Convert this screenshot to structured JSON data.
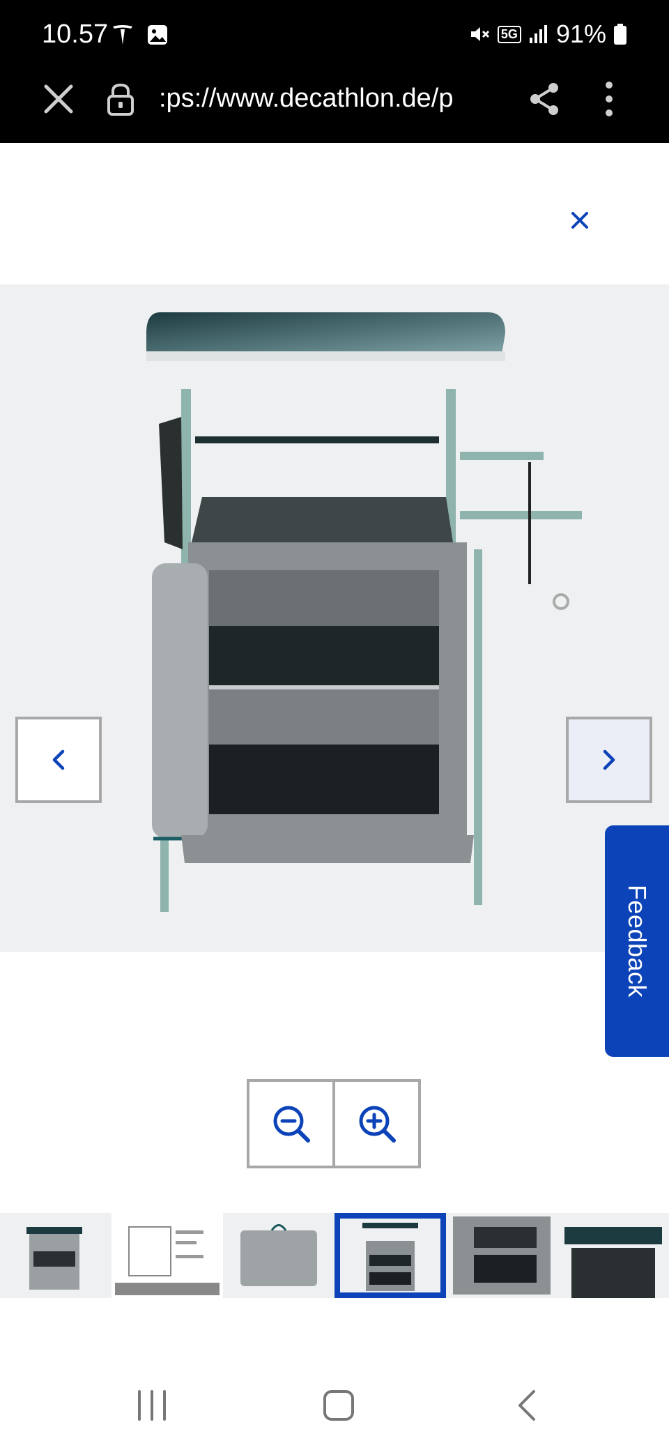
{
  "status_bar": {
    "time": "10.57",
    "battery": "91%",
    "network": "5G"
  },
  "browser": {
    "url": ":ps://www.decathlon.de/p"
  },
  "viewer": {
    "feedback_label": "Feedback",
    "thumbnails": [
      {
        "name": "thumbnail-1"
      },
      {
        "name": "thumbnail-2"
      },
      {
        "name": "thumbnail-3"
      },
      {
        "name": "thumbnail-4",
        "selected": true
      },
      {
        "name": "thumbnail-5"
      },
      {
        "name": "thumbnail-6"
      }
    ]
  },
  "colors": {
    "accent": "#0c43b8",
    "border": "#a8a8a8",
    "stage": "#eef0f1"
  }
}
